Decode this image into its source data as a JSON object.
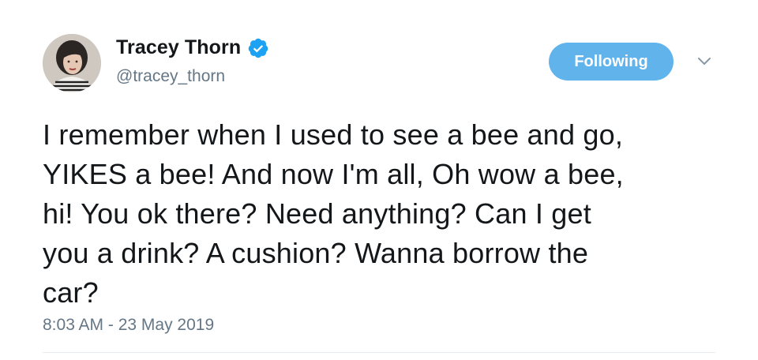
{
  "author": {
    "display_name": "Tracey Thorn",
    "handle": "@tracey_thorn",
    "verified": true,
    "avatar_icon": "profile-photo"
  },
  "actions": {
    "follow_label": "Following",
    "follow_color": "#61b3ec",
    "menu_icon": "chevron-down-icon"
  },
  "tweet": {
    "text": "I remember when I used to see a bee and go,\nYIKES a bee! And now I'm all, Oh wow a bee,\nhi! You ok there? Need anything? Can I get\nyou a drink? A cushion? Wanna borrow the\ncar?",
    "timestamp": "8:03 AM - 23 May 2019"
  },
  "colors": {
    "verified_badge": "#1da1f2",
    "secondary_text": "#657786"
  }
}
